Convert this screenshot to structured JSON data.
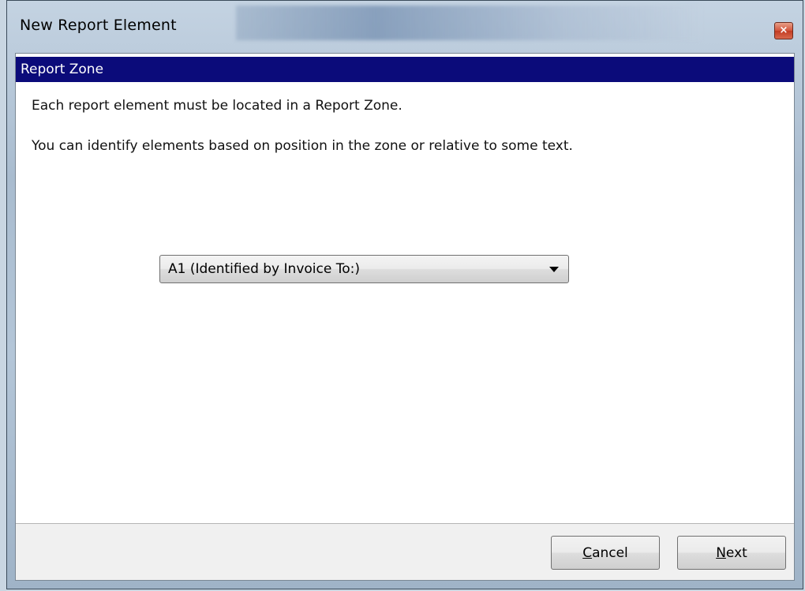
{
  "window": {
    "title": "New Report Element",
    "close_label": "×"
  },
  "section": {
    "header": "Report Zone"
  },
  "description": {
    "line1": "Each report element must be located in a Report Zone.",
    "line2": "You can identify elements based on position in the zone or relative to some text."
  },
  "zone_select": {
    "selected": "A1 (Identified by Invoice To:)"
  },
  "buttons": {
    "cancel": {
      "accel": "C",
      "rest": "ancel"
    },
    "next": {
      "accel": "N",
      "rest": "ext"
    }
  },
  "icons": {
    "close": "close-icon",
    "dropdown": "chevron-down-icon"
  },
  "colors": {
    "header_bg": "#0b0b7a",
    "close_btn": "#c23b22"
  }
}
